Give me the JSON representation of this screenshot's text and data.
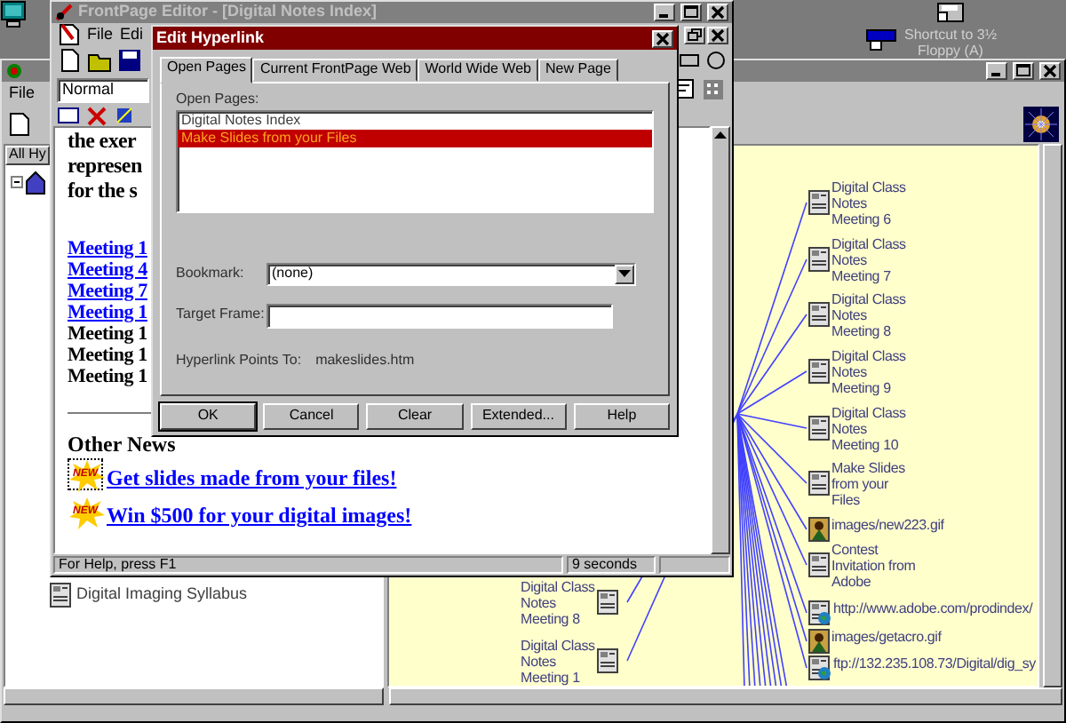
{
  "desktop": {
    "shortcut": {
      "lines": [
        "Shortcut to 3½",
        "Floppy (A)"
      ]
    }
  },
  "explorer": {
    "menu": [
      "File"
    ],
    "tree_header": "All Hy",
    "tree": [
      {
        "label": "Digital Imaging Syllabus"
      }
    ],
    "graph": {
      "right": [
        {
          "lines": [
            "Digital Class",
            "Notes",
            "Meeting 6"
          ],
          "kind": "page"
        },
        {
          "lines": [
            "Digital Class",
            "Notes",
            "Meeting 7"
          ],
          "kind": "page"
        },
        {
          "lines": [
            "Digital Class",
            "Notes",
            "Meeting 8"
          ],
          "kind": "page"
        },
        {
          "lines": [
            "Digital Class",
            "Notes",
            "Meeting 9"
          ],
          "kind": "page"
        },
        {
          "lines": [
            "Digital Class",
            "Notes",
            "Meeting 10"
          ],
          "kind": "page"
        },
        {
          "lines": [
            "Make Slides",
            "from your",
            "Files"
          ],
          "kind": "page"
        },
        {
          "lines": [
            "images/new223.gif"
          ],
          "kind": "image"
        },
        {
          "lines": [
            "Contest",
            "Invitation from",
            "Adobe"
          ],
          "kind": "page"
        },
        {
          "lines": [
            "http://www.adobe.com/prodindex/"
          ],
          "kind": "web"
        },
        {
          "lines": [
            "images/getacro.gif"
          ],
          "kind": "image"
        },
        {
          "lines": [
            "ftp://132.235.108.73/Digital/dig_sy"
          ],
          "kind": "web"
        }
      ],
      "lower": [
        {
          "lines": [
            "Digital Class",
            "Notes",
            "Meeting 8"
          ],
          "kind": "page"
        },
        {
          "lines": [
            "Digital Class",
            "Notes",
            "Meeting 1"
          ],
          "kind": "page"
        }
      ]
    }
  },
  "editor": {
    "title": "FrontPage Editor - [Digital Notes Index]",
    "menu": [
      "File",
      "Edi"
    ],
    "style": "Normal",
    "intro": [
      "the exer",
      "represen",
      "for the s"
    ],
    "meetings": [
      {
        "text": "Meeting 1",
        "link": true
      },
      {
        "text": "Meeting 4",
        "link": true
      },
      {
        "text": "Meeting 7",
        "link": true
      },
      {
        "text": "Meeting 1",
        "link": true
      },
      {
        "text": "Meeting 1",
        "link": false
      },
      {
        "text": "Meeting 1",
        "link": false
      },
      {
        "text": "Meeting 1",
        "link": false
      }
    ],
    "heading": "Other News",
    "news": [
      {
        "badge": "NEW",
        "text": "Get slides made from your files!",
        "selected": true
      },
      {
        "badge": "NEW",
        "text": "Win $500 for your digital images!",
        "selected": false
      }
    ],
    "status": "For Help, press F1",
    "timer": "9 seconds"
  },
  "dialog": {
    "title": "Edit Hyperlink",
    "tabs": [
      {
        "label": "Open Pages",
        "selected": true
      },
      {
        "label": "Current FrontPage Web",
        "selected": false
      },
      {
        "label": "World Wide Web",
        "selected": false
      },
      {
        "label": "New Page",
        "selected": false
      }
    ],
    "list_label": "Open Pages:",
    "pages": [
      {
        "label": "Digital Notes Index",
        "selected": false
      },
      {
        "label": "Make Slides from your Files",
        "selected": true
      }
    ],
    "bookmark": {
      "label": "Bookmark:",
      "value": "(none)"
    },
    "target_frame": {
      "label": "Target Frame:"
    },
    "points_to": {
      "label": "Hyperlink Points To:",
      "value": "makeslides.htm"
    },
    "buttons": [
      "OK",
      "Cancel",
      "Clear",
      "Extended...",
      "Help"
    ]
  }
}
